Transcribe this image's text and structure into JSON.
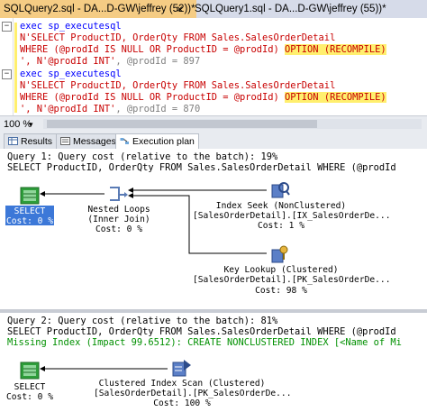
{
  "tabs": {
    "active": "SQLQuery2.sql - DA...D-GW\\jeffrey (52))*",
    "close": "×",
    "inactive": "SQLQuery1.sql - DA...D-GW\\jeffrey (55))*"
  },
  "editor": {
    "l1_kw": "exec sp_executesql",
    "l2": "N'SELECT ProductID, OrderQty FROM Sales.SalesOrderDetail",
    "l3": "WHERE (@prodId IS NULL OR ProductID = @prodId) ",
    "l3_hl": "OPTION (RECOMPILE)",
    "l4_str": "', N'@prodId INT'",
    "l4_rest": ", @prodId = 897",
    "l5_kw": "exec sp_executesql",
    "l6": "N'SELECT ProductID, OrderQty FROM Sales.SalesOrderDetail",
    "l7": "WHERE (@prodId IS NULL OR ProductID = @prodId) ",
    "l7_hl": "OPTION (RECOMPILE)",
    "l8_str": "', N'@prodId INT'",
    "l8_rest": ", @prodId = 870"
  },
  "zoom": {
    "value": "100 %",
    "dropdown": "▾"
  },
  "result_tabs": [
    "Results",
    "Messages",
    "Execution plan"
  ],
  "query1": {
    "header": "Query 1: Query cost (relative to the batch): 19%",
    "sql": "SELECT ProductID, OrderQty FROM Sales.SalesOrderDetail WHERE (@prodId",
    "select": {
      "name": "SELECT",
      "cost": "Cost: 0 %"
    },
    "nested": {
      "name": "Nested Loops",
      "sub": "(Inner Join)",
      "cost": "Cost: 0 %"
    },
    "seek": {
      "name": "Index Seek (NonClustered)",
      "obj": "[SalesOrderDetail].[IX_SalesOrderDe...",
      "cost": "Cost: 1 %"
    },
    "lookup": {
      "name": "Key Lookup (Clustered)",
      "obj": "[SalesOrderDetail].[PK_SalesOrderDe...",
      "cost": "Cost: 98 %"
    }
  },
  "query2": {
    "header": "Query 2: Query cost (relative to the batch): 81%",
    "sql": "SELECT ProductID, OrderQty FROM Sales.SalesOrderDetail WHERE (@prodId",
    "missing": "Missing Index (Impact 99.6512): CREATE NONCLUSTERED INDEX [<Name of Mi",
    "select": {
      "name": "SELECT",
      "cost": "Cost: 0 %"
    },
    "scan": {
      "name": "Clustered Index Scan (Clustered)",
      "obj": "[SalesOrderDetail].[PK_SalesOrderDe...",
      "cost": "Cost: 100 %"
    }
  },
  "colors": {
    "tab_active": "#f5cc84",
    "keyword": "#0000ff",
    "string": "#c80000",
    "highlight": "#ffef6e",
    "missing_index": "#009000",
    "selected_node": "#3c78d8"
  }
}
